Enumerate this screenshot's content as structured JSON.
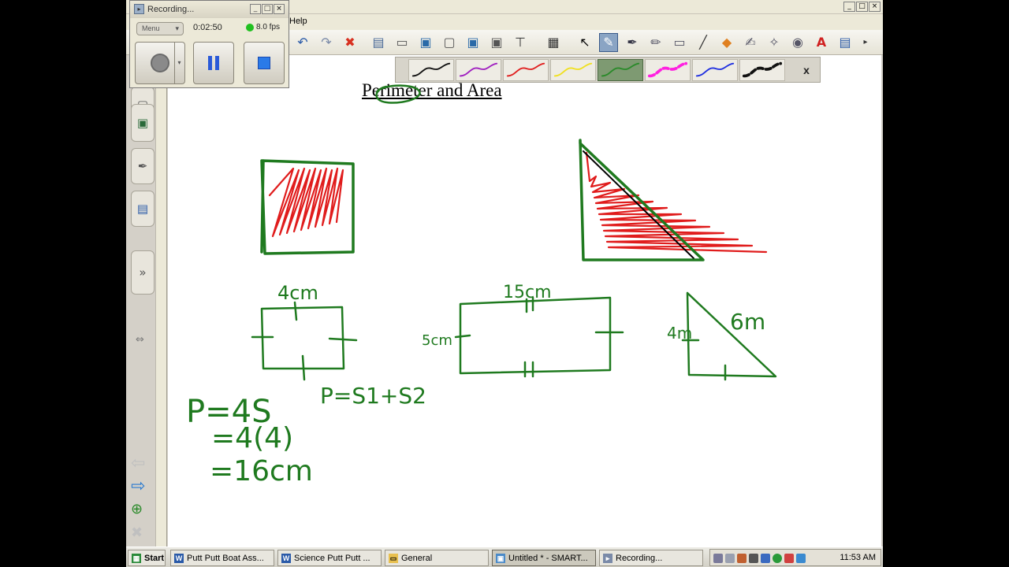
{
  "app": {
    "menu_help": "Help",
    "pen_close": "x",
    "title_buttons": [
      "_",
      "□",
      "×"
    ]
  },
  "toolbar_icons": [
    "undo-icon",
    "redo-icon",
    "delete-icon",
    "screen-shade-icon",
    "screen-icon",
    "dual-screen-icon",
    "screen-capture-icon",
    "capture-icon",
    "toolbar-icon",
    "table-icon",
    "select-icon",
    "pen-icon",
    "creative-pen-icon",
    "highlighter-icon",
    "eraser-icon",
    "line-icon",
    "shapes-icon",
    "magic-pen-icon",
    "fill-icon",
    "text-icon",
    "properties-icon"
  ],
  "pen_colors": [
    "#111111",
    "#a020c0",
    "#e02020",
    "#f0e020",
    "#2a8a2a",
    "#ff20e0",
    "#2030e0",
    "#111111"
  ],
  "document": {
    "title": "Perimeter and Area"
  },
  "ink": {
    "labels": {
      "square_side": "4cm",
      "rect_long": "15cm",
      "rect_short": "5cm",
      "tri_short": "4m",
      "tri_long": "6m",
      "formula1": "P=4S",
      "formula1_step2": "=4(4)",
      "formula1_step3": "=16cm",
      "formula2": "P=S1+S2"
    },
    "colors": {
      "green": "#1f7a1f",
      "red": "#e01c1c",
      "black": "#000000"
    }
  },
  "recorder": {
    "title": "Recording...",
    "menu_label": "Menu",
    "time": "0:02:50",
    "fps": "8.0 fps"
  },
  "taskbar": {
    "start": "Start",
    "tasks": [
      "Putt Putt Boat Ass...",
      "Science Putt Putt ...",
      "General",
      "Untitled * - SMART...",
      "Recording..."
    ],
    "clock": "11:53 AM"
  }
}
